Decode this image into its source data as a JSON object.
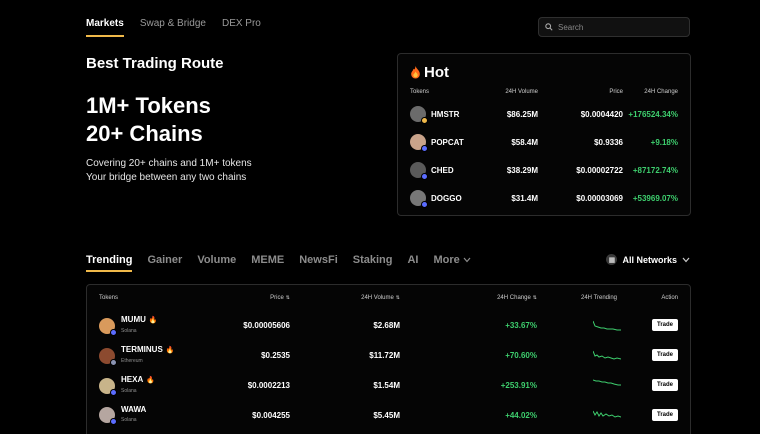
{
  "nav": {
    "items": [
      "Markets",
      "Swap & Bridge",
      "DEX Pro"
    ]
  },
  "search": {
    "placeholder": "Search"
  },
  "hero": {
    "subtitle": "Best Trading Route",
    "title_line1": "1M+ Tokens",
    "title_line2": "20+ Chains",
    "desc_line1": "Covering 20+ chains and 1M+ tokens",
    "desc_line2": "Your bridge between any two chains"
  },
  "hot": {
    "title": "Hot",
    "headers": {
      "tokens": "Tokens",
      "volume": "24H Volume",
      "price": "Price",
      "change": "24H Change"
    },
    "rows": [
      {
        "name": "HMSTR",
        "volume": "$86.25M",
        "price": "$0.0004420",
        "change": "+176524.34%"
      },
      {
        "name": "POPCAT",
        "volume": "$58.4M",
        "price": "$0.9336",
        "change": "+9.18%"
      },
      {
        "name": "CHED",
        "volume": "$38.29M",
        "price": "$0.00002722",
        "change": "+87172.74%"
      },
      {
        "name": "DOGGO",
        "volume": "$31.4M",
        "price": "$0.00003069",
        "change": "+53969.07%"
      }
    ]
  },
  "tabs": [
    "Trending",
    "Gainer",
    "Volume",
    "MEME",
    "NewsFi",
    "Staking",
    "AI",
    "More"
  ],
  "networks": {
    "label": "All Networks"
  },
  "table": {
    "headers": {
      "tokens": "Tokens",
      "price": "Price",
      "volume": "24H Volume",
      "change": "24H Change",
      "trending": "24H Trending",
      "action": "Action"
    },
    "rows": [
      {
        "name": "MUMU",
        "chain": "Solana",
        "price": "$0.00005606",
        "volume": "$2.68M",
        "change": "+33.67%",
        "action": "Trade"
      },
      {
        "name": "TERMINUS",
        "chain": "Ethereum",
        "price": "$0.2535",
        "volume": "$11.72M",
        "change": "+70.60%",
        "action": "Trade"
      },
      {
        "name": "HEXA",
        "chain": "Solana",
        "price": "$0.0002213",
        "volume": "$1.54M",
        "change": "+253.91%",
        "action": "Trade"
      },
      {
        "name": "WAWA",
        "chain": "Solana",
        "price": "$0.004255",
        "volume": "$5.45M",
        "change": "+44.02%",
        "action": "Trade"
      }
    ]
  },
  "colors": {
    "accent": "#f0b94a",
    "positive": "#3ecf6e",
    "background": "#000000"
  }
}
